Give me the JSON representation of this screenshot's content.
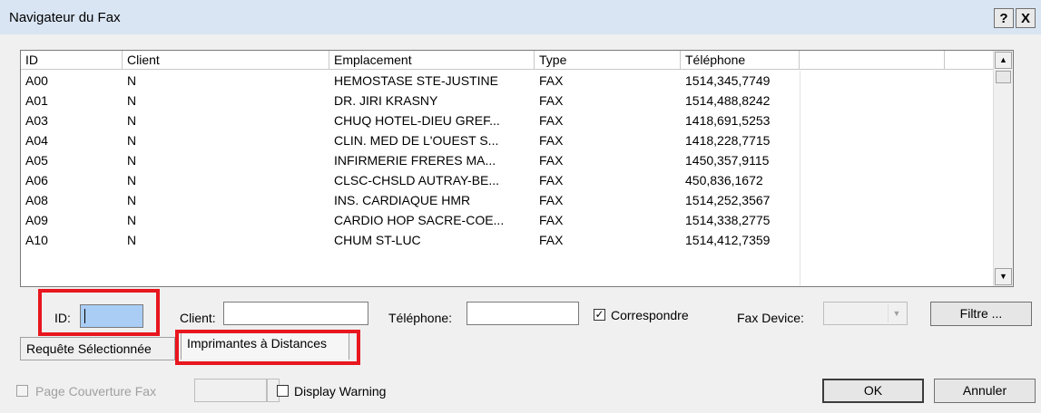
{
  "window": {
    "title": "Navigateur du Fax",
    "help_label": "?",
    "close_label": "X"
  },
  "table": {
    "columns": [
      "ID",
      "Client",
      "Emplacement",
      "Type",
      "Téléphone"
    ],
    "rows": [
      [
        "A00",
        "N",
        "HEMOSTASE STE-JUSTINE",
        "FAX",
        "1514,345,7749"
      ],
      [
        "A01",
        "N",
        "DR. JIRI KRASNY",
        "FAX",
        "1514,488,8242"
      ],
      [
        "A03",
        "N",
        "CHUQ HOTEL-DIEU GREF...",
        "FAX",
        "1418,691,5253"
      ],
      [
        "A04",
        "N",
        "CLIN. MED DE L'OUEST S...",
        "FAX",
        "1418,228,7715"
      ],
      [
        "A05",
        "N",
        "INFIRMERIE FRERES MA...",
        "FAX",
        "1450,357,9115"
      ],
      [
        "A06",
        "N",
        "CLSC-CHSLD AUTRAY-BE...",
        "FAX",
        "450,836,1672"
      ],
      [
        "A08",
        "N",
        "INS. CARDIAQUE HMR",
        "FAX",
        "1514,252,3567"
      ],
      [
        "A09",
        "N",
        "CARDIO HOP SACRE-COE...",
        "FAX",
        "1514,338,2775"
      ],
      [
        "A10",
        "N",
        "CHUM ST-LUC",
        "FAX",
        "1514,412,7359"
      ]
    ]
  },
  "filters": {
    "id_label": "ID:",
    "client_label": "Client:",
    "phone_label": "Téléphone:",
    "match_label": "Correspondre",
    "fax_device_label": "Fax Device:",
    "filter_button": "Filtre ..."
  },
  "tabs": [
    "Requête Sélectionnée",
    "Imprimantes à Distances"
  ],
  "footer": {
    "cover_page_label": "Page Couverture Fax",
    "display_warning_label": "Display Warning",
    "ok_button": "OK",
    "cancel_button": "Annuler"
  }
}
